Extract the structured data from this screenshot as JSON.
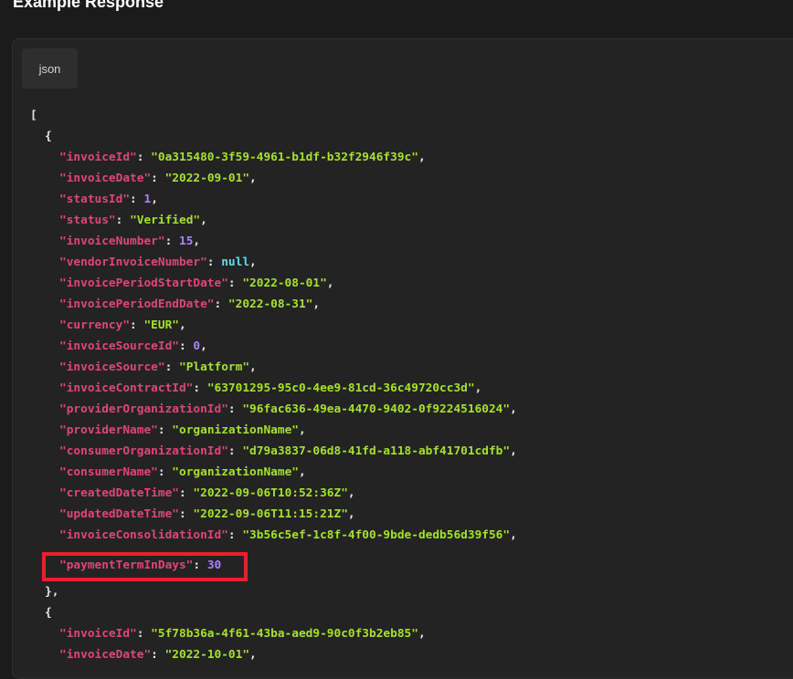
{
  "header": {
    "title": "Example Response"
  },
  "tab": {
    "label": "json"
  },
  "code": {
    "open_bracket": "[",
    "open_brace": "{",
    "close_brace_comma": "},",
    "line1": {
      "key": "\"invoiceId\"",
      "colon": ": ",
      "value": "\"0a315480-3f59-4961-b1df-b32f2946f39c\"",
      "end": ","
    },
    "line2": {
      "key": "\"invoiceDate\"",
      "colon": ": ",
      "value": "\"2022-09-01\"",
      "end": ","
    },
    "line3": {
      "key": "\"statusId\"",
      "colon": ": ",
      "value": "1",
      "end": ","
    },
    "line4": {
      "key": "\"status\"",
      "colon": ": ",
      "value": "\"Verified\"",
      "end": ","
    },
    "line5": {
      "key": "\"invoiceNumber\"",
      "colon": ": ",
      "value": "15",
      "end": ","
    },
    "line6": {
      "key": "\"vendorInvoiceNumber\"",
      "colon": ": ",
      "value": "null",
      "end": ","
    },
    "line7": {
      "key": "\"invoicePeriodStartDate\"",
      "colon": ": ",
      "value": "\"2022-08-01\"",
      "end": ","
    },
    "line8": {
      "key": "\"invoicePeriodEndDate\"",
      "colon": ": ",
      "value": "\"2022-08-31\"",
      "end": ","
    },
    "line9": {
      "key": "\"currency\"",
      "colon": ": ",
      "value": "\"EUR\"",
      "end": ","
    },
    "line10": {
      "key": "\"invoiceSourceId\"",
      "colon": ": ",
      "value": "0",
      "end": ","
    },
    "line11": {
      "key": "\"invoiceSource\"",
      "colon": ": ",
      "value": "\"Platform\"",
      "end": ","
    },
    "line12": {
      "key": "\"invoiceContractId\"",
      "colon": ": ",
      "value": "\"63701295-95c0-4ee9-81cd-36c49720cc3d\"",
      "end": ","
    },
    "line13": {
      "key": "\"providerOrganizationId\"",
      "colon": ": ",
      "value": "\"96fac636-49ea-4470-9402-0f9224516024\"",
      "end": ","
    },
    "line14": {
      "key": "\"providerName\"",
      "colon": ": ",
      "value": "\"organizationName\"",
      "end": ","
    },
    "line15": {
      "key": "\"consumerOrganizationId\"",
      "colon": ": ",
      "value": "\"d79a3837-06d8-41fd-a118-abf41701cdfb\"",
      "end": ","
    },
    "line16": {
      "key": "\"consumerName\"",
      "colon": ": ",
      "value": "\"organizationName\"",
      "end": ","
    },
    "line17": {
      "key": "\"createdDateTime\"",
      "colon": ": ",
      "value": "\"2022-09-06T10:52:36Z\"",
      "end": ","
    },
    "line18": {
      "key": "\"updatedDateTime\"",
      "colon": ": ",
      "value": "\"2022-09-06T11:15:21Z\"",
      "end": ","
    },
    "line19": {
      "key": "\"invoiceConsolidationId\"",
      "colon": ": ",
      "value": "\"3b56c5ef-1c8f-4f00-9bde-dedb56d39f56\"",
      "end": ","
    },
    "line20": {
      "key": "\"paymentTermInDays\"",
      "colon": ": ",
      "value": "30",
      "end": ""
    },
    "line21": {
      "key": "\"invoiceId\"",
      "colon": ": ",
      "value": "\"5f78b36a-4f61-43ba-aed9-90c0f3b2eb85\"",
      "end": ","
    },
    "line22": {
      "key": "\"invoiceDate\"",
      "colon": ": ",
      "value": "\"2022-10-01\"",
      "end": ","
    }
  },
  "colors": {
    "key": "#e0457b",
    "string": "#a6e22e",
    "number": "#ae81ff",
    "null": "#66d9ef",
    "punctuation": "#e8e8e8",
    "highlight_border": "#e8202a"
  }
}
